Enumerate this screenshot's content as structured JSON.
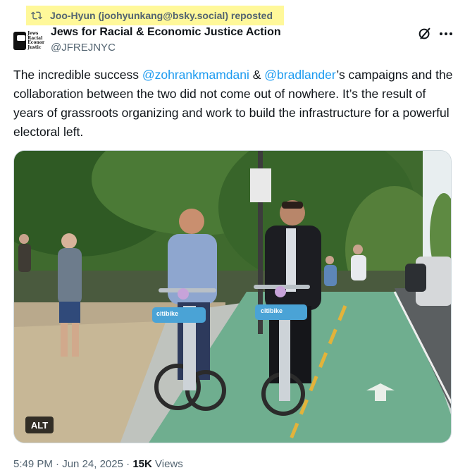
{
  "repost": {
    "text": "Joo-Hyun (joohyunkang@bsky.social) reposted",
    "highlight_color": "#fff89a"
  },
  "author": {
    "name": "Jews for Racial & Economic Justice Action",
    "handle": "@JFREJNYC",
    "avatar_text": [
      "Jews",
      "Racial",
      "Econor",
      "Justic"
    ]
  },
  "tweet": {
    "text_before": "The incredible success ",
    "mention_1": "@zohrankmamdani",
    "text_between": " & ",
    "mention_2": "@bradlander",
    "text_after": "’s campaigns and the collaboration between the two did not come out of nowhere. It’s the result of years of grassroots organizing and work to build the infrastructure for a powerful electoral left."
  },
  "media": {
    "alt_label": "ALT",
    "bike_brand": "citibike"
  },
  "meta": {
    "time": "5:49 PM",
    "separator_1": " · ",
    "date": "Jun 24, 2025",
    "separator_2": " · ",
    "views_count": "15K",
    "views_label": " Views"
  },
  "icons": {
    "repost": "repost-icon",
    "grok": "grok-icon",
    "more": "more-icon"
  },
  "colors": {
    "link": "#1d9bf0",
    "secondary_text": "#536471",
    "primary_text": "#0f1419"
  }
}
